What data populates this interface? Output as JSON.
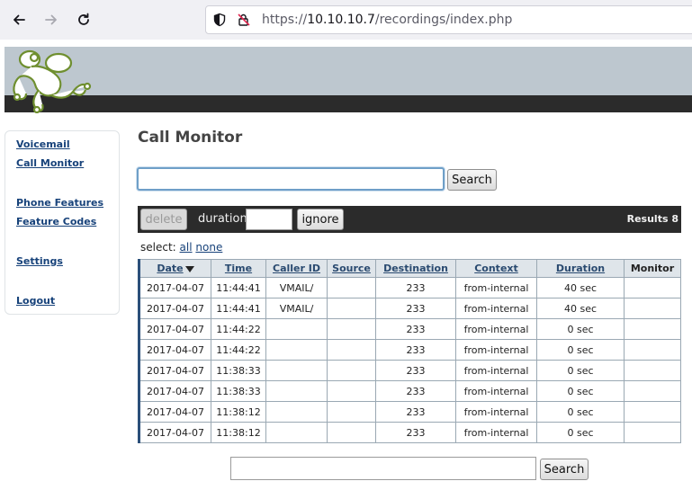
{
  "browser": {
    "url_prefix": "https://",
    "url_host": "10.10.10.7",
    "url_path": "/recordings/index.php"
  },
  "sidebar": {
    "items": [
      {
        "id": "voicemail",
        "label": "Voicemail"
      },
      {
        "id": "call-monitor",
        "label": "Call Monitor"
      },
      {
        "id": "phone-features",
        "label": "Phone Features"
      },
      {
        "id": "feature-codes",
        "label": "Feature Codes"
      },
      {
        "id": "settings",
        "label": "Settings"
      },
      {
        "id": "logout",
        "label": "Logout"
      }
    ]
  },
  "main": {
    "title": "Call Monitor",
    "search_button": "Search",
    "toolbar": {
      "delete_label": "delete",
      "duration_label": "duration",
      "ignore_label": "ignore",
      "results_label": "Results 8"
    },
    "select": {
      "label": "select:",
      "all": "all",
      "none": "none"
    },
    "table": {
      "headers": [
        "Date",
        "Time",
        "Caller ID",
        "Source",
        "Destination",
        "Context",
        "Duration",
        "Monitor"
      ],
      "rows": [
        [
          "2017-04-07",
          "11:44:41",
          "VMAIL/",
          "",
          "233",
          "from-internal",
          "40 sec",
          ""
        ],
        [
          "2017-04-07",
          "11:44:41",
          "VMAIL/",
          "",
          "233",
          "from-internal",
          "40 sec",
          ""
        ],
        [
          "2017-04-07",
          "11:44:22",
          "",
          "",
          "233",
          "from-internal",
          "0 sec",
          ""
        ],
        [
          "2017-04-07",
          "11:44:22",
          "",
          "",
          "233",
          "from-internal",
          "0 sec",
          ""
        ],
        [
          "2017-04-07",
          "11:38:33",
          "",
          "",
          "233",
          "from-internal",
          "0 sec",
          ""
        ],
        [
          "2017-04-07",
          "11:38:33",
          "",
          "",
          "233",
          "from-internal",
          "0 sec",
          ""
        ],
        [
          "2017-04-07",
          "11:38:12",
          "",
          "",
          "233",
          "from-internal",
          "0 sec",
          ""
        ],
        [
          "2017-04-07",
          "11:38:12",
          "",
          "",
          "233",
          "from-internal",
          "0 sec",
          ""
        ]
      ]
    },
    "bottom_search_button": "Search"
  },
  "colors": {
    "banner": "#bdc7cf",
    "toolbar": "#2b2b2b",
    "link": "#17427a"
  }
}
